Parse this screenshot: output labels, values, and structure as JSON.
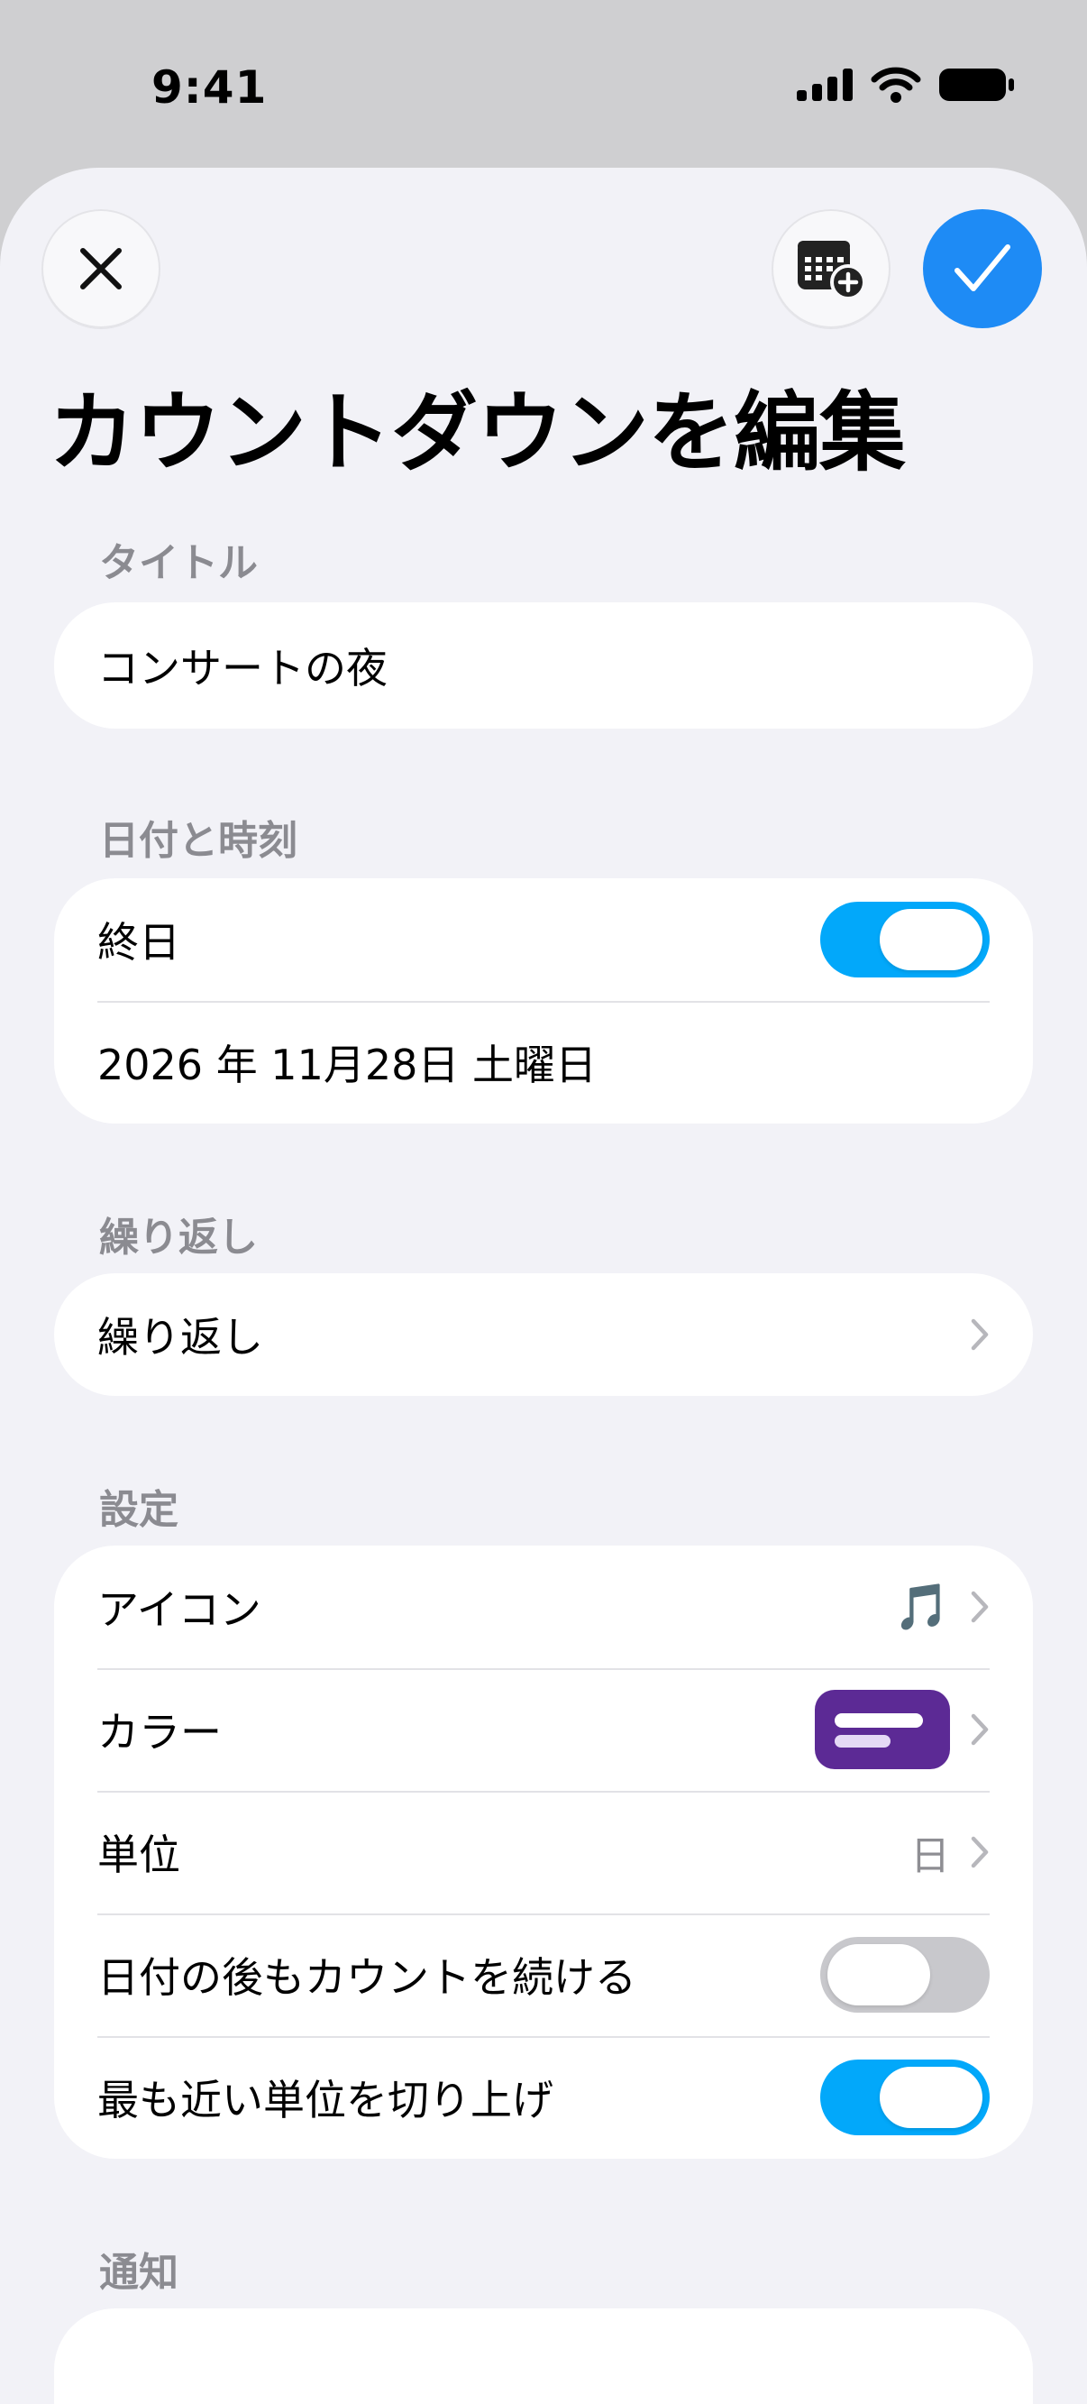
{
  "status_bar": {
    "time": "9:41"
  },
  "header": {
    "title": "カウントダウンを編集"
  },
  "sections": {
    "title": {
      "header": "タイトル",
      "value": "コンサートの夜"
    },
    "datetime": {
      "header": "日付と時刻",
      "all_day_label": "終日",
      "all_day": true,
      "date_value": "2026 年 11月28日 土曜日"
    },
    "repeat": {
      "header": "繰り返し",
      "row_label": "繰り返し"
    },
    "settings": {
      "header": "設定",
      "icon_label": "アイコン",
      "icon_value": "🎵",
      "color_label": "カラー",
      "color_value": "#5C2A95",
      "unit_label": "単位",
      "unit_value": "日",
      "continue_label": "日付の後もカウントを続ける",
      "continue_on": false,
      "round_label": "最も近い単位を切り上げ",
      "round_on": true
    },
    "notifications": {
      "header": "通知"
    }
  },
  "colors": {
    "accent": "#1E8BF5",
    "toggle_on": "#02A8FA",
    "background": "#F2F2F7"
  }
}
